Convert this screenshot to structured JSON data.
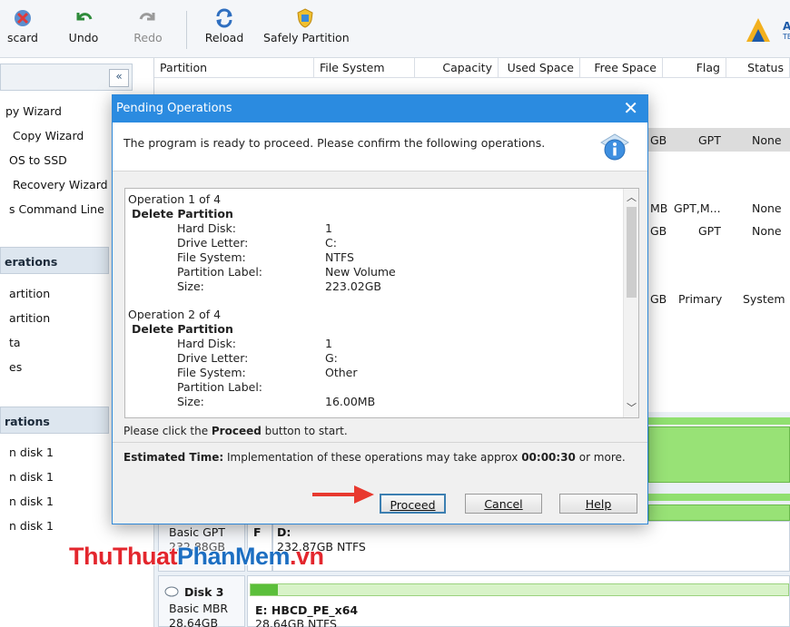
{
  "toolbar": {
    "discard": "scard",
    "undo": "Undo",
    "redo": "Redo",
    "reload": "Reload",
    "safely_partition": "Safely Partition",
    "logo_text_1": "A",
    "logo_text_2": "TE"
  },
  "sidebar": {
    "wizard_items": [
      "py Wizard",
      "Copy Wizard",
      "OS to SSD",
      "Recovery Wizard",
      "s Command Line"
    ],
    "section_operations": "erations",
    "operation_items": [
      "artition",
      "artition",
      "ta",
      "es"
    ],
    "section_operations2": "rations",
    "pending_items": [
      "n disk 1",
      "n disk 1",
      "n disk 1",
      "n disk 1"
    ]
  },
  "table": {
    "columns": [
      "Partition",
      "File System",
      "Capacity",
      "Used Space",
      "Free Space",
      "Flag",
      "Status"
    ],
    "rows": [
      {
        "free": "GB",
        "flag": "GPT",
        "status": "None"
      },
      {
        "free": "MB",
        "flag": "GPT,M...",
        "status": "None"
      },
      {
        "free": "GB",
        "flag": "GPT",
        "status": "None"
      },
      {
        "free": "GB",
        "flag": "Primary",
        "status": "System"
      }
    ]
  },
  "disks": {
    "disk2_type": "Basic GPT",
    "disk2_size": "232.88GB",
    "disk2_letter": "F",
    "disk2_part_name": "D:",
    "disk2_part_info": "232.87GB NTFS",
    "disk3_name": "Disk 3",
    "disk3_type": "Basic MBR",
    "disk3_size": "28.64GB",
    "disk3_part_name": "E: HBCD_PE_x64",
    "disk3_part_info": "28.64GB NTFS"
  },
  "watermark": {
    "part1": "ThuThuat",
    "part2": "PhanMem",
    "part3": ".vn"
  },
  "dialog": {
    "title": "Pending Operations",
    "message": "The program is ready to proceed. Please confirm the following operations.",
    "operations": [
      {
        "header": "Operation 1 of 4",
        "action": "Delete Partition",
        "fields": [
          {
            "k": "Hard Disk:",
            "v": "1"
          },
          {
            "k": "Drive Letter:",
            "v": "C:"
          },
          {
            "k": "File System:",
            "v": "NTFS"
          },
          {
            "k": "Partition Label:",
            "v": "New Volume"
          },
          {
            "k": "Size:",
            "v": "223.02GB"
          }
        ]
      },
      {
        "header": "Operation 2 of 4",
        "action": "Delete Partition",
        "fields": [
          {
            "k": "Hard Disk:",
            "v": "1"
          },
          {
            "k": "Drive Letter:",
            "v": "G:"
          },
          {
            "k": "File System:",
            "v": "Other"
          },
          {
            "k": "Partition Label:",
            "v": ""
          },
          {
            "k": "Size:",
            "v": "16.00MB"
          }
        ]
      }
    ],
    "hint_prefix": "Please click the ",
    "hint_bold": "Proceed",
    "hint_suffix": " button to start.",
    "est_label": "Estimated Time:",
    "est_text": " Implementation of these operations may take approx ",
    "est_time": "00:00:30",
    "est_suffix": " or more.",
    "proceed": "Proceed",
    "cancel": "Cancel",
    "help": "Help"
  },
  "colors": {
    "title_bar": "#2b8be0",
    "disk_bar": "#90e070",
    "arrow": "#e8392f",
    "watermark_red": "#e3262d",
    "watermark_blue": "#1d6fc2"
  }
}
